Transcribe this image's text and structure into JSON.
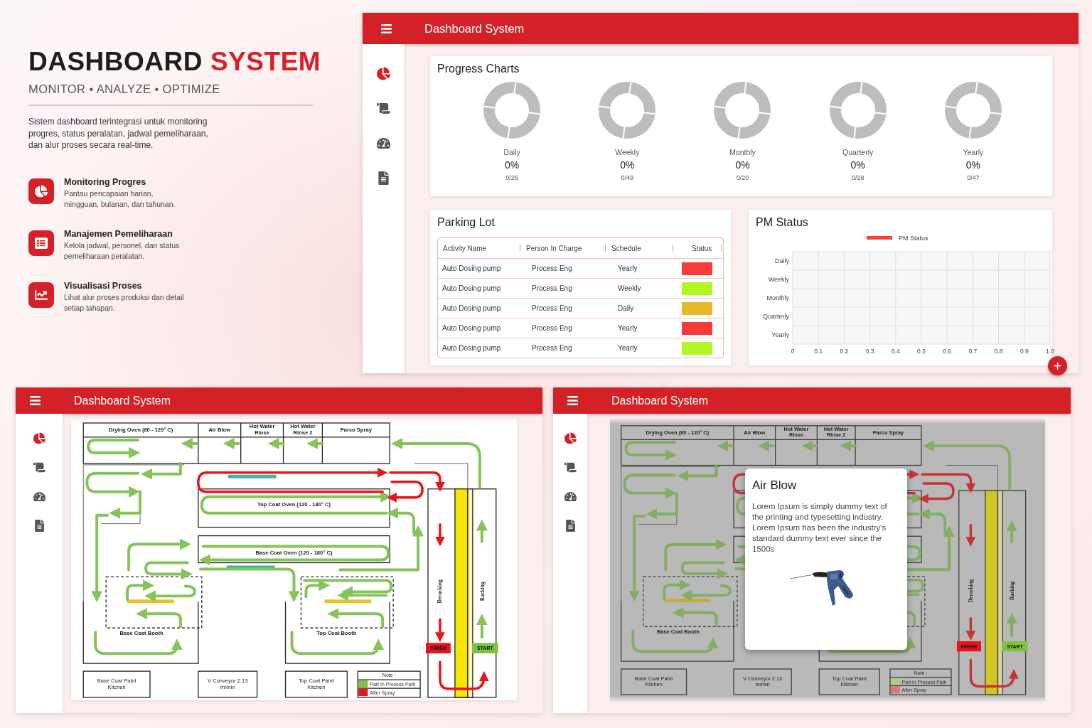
{
  "hero": {
    "title_main": "DASHBOARD",
    "title_accent": "SYSTEM",
    "tagline": "MONITOR • ANALYZE • OPTIMIZE",
    "description": "Sistem dashboard terintegrasi untuk monitoring progres, status peralatan, jadwal pemeliharaan, dan alur proses secara real-time.",
    "features": [
      {
        "title": "Monitoring Progres",
        "text": "Pantau pencapaian harian, mingguan, bulanan, dan tahunan."
      },
      {
        "title": "Manajemen Pemeliharaan",
        "text": "Kelola jadwal, personel, dan status pemeliharaan peralatan."
      },
      {
        "title": "Visualisasi Proses",
        "text": "Lihat alur proses produksi dan detail setiap tahapan."
      }
    ]
  },
  "dashboard_window": {
    "title": "Dashboard System",
    "sidebar": [
      {
        "selected": true
      },
      {
        "selected": false
      },
      {
        "selected": false
      },
      {
        "selected": false
      }
    ],
    "progress_charts": {
      "title": "Progress Charts",
      "items": [
        {
          "label": "Daily",
          "percent": "0%",
          "count": "0/26",
          "level": 0
        },
        {
          "label": "Weekly",
          "percent": "0%",
          "count": "0/49",
          "level": 0
        },
        {
          "label": "Monthly",
          "percent": "0%",
          "count": "0/20",
          "level": 0
        },
        {
          "label": "Quarterly",
          "percent": "0%",
          "count": "0/28",
          "level": 0
        },
        {
          "label": "Yearly",
          "percent": "0%",
          "count": "0/47",
          "level": 0
        }
      ]
    },
    "parking_lot": {
      "title": "Parking Lot",
      "columns": [
        "Activity Name",
        "Person In Charge",
        "Schedule",
        "Status"
      ],
      "rows": [
        {
          "activity": "Auto Dosing pump",
          "person": "Process Eng",
          "schedule": "Yearly",
          "color": "#f83a3a"
        },
        {
          "activity": "Auto Dosing pump",
          "person": "Process Eng",
          "schedule": "Weekly",
          "color": "#b2f723"
        },
        {
          "activity": "Auto Dosing pump",
          "person": "Process Eng",
          "schedule": "Daily",
          "color": "#e8b92a"
        },
        {
          "activity": "Auto Dosing pump",
          "person": "Process Eng",
          "schedule": "Yearly",
          "color": "#f83a3a"
        },
        {
          "activity": "Auto Dosing pump",
          "person": "Process Eng",
          "schedule": "Yearly",
          "color": "#b2f723"
        }
      ]
    },
    "pm_status": {
      "title": "PM Status",
      "chart_data": {
        "type": "bar",
        "orientation": "horizontal",
        "categories": [
          "Daily",
          "Weekly",
          "Monthly",
          "Quarterly",
          "Yearly"
        ],
        "series": [
          {
            "name": "PM Status",
            "color": "#f44336",
            "values": [
              0,
              0,
              0,
              0,
              0
            ]
          }
        ],
        "xlim": [
          0,
          1
        ],
        "grid": true,
        "xticks": [
          0,
          0.1,
          0.2,
          0.3,
          0.4,
          0.5,
          0.6,
          0.7,
          0.8,
          0.9,
          {
            "value": 1,
            "label": "1.0"
          }
        ]
      }
    },
    "fab": "+"
  },
  "process_windows": [
    {
      "title": "Dashboard System",
      "sidebar": [
        {
          "selected": true
        },
        {
          "selected": false
        },
        {
          "selected": false
        },
        {
          "selected": false
        }
      ],
      "diagram": {
        "stations": [
          "Drying Oven (80 - 120° C)",
          "Air Blow",
          "Hot Water Rinse",
          "Hot Water Rinse 2",
          "Parco Spray"
        ],
        "top_coat_oven": "Top Coat Oven (120 - 180° C)",
        "base_coat_oven": "Base Coat Oven (120 - 180° C)",
        "base_coat_booth": "Base Coat Booth",
        "top_coat_booth": "Top Coat Booth",
        "deracking": "Deracking",
        "racking": "Racking",
        "finish": "FINISH",
        "start": "START",
        "facilities": [
          "Base Coat Paint Kitchen",
          "V Conveyor 2.13 m/min",
          "Top Coat Paint Kitchen"
        ],
        "note": {
          "title": "Note :",
          "items": [
            {
              "label": "Part In Process Path",
              "color": "#7dc242"
            },
            {
              "label": "After Spray",
              "color": "#e8141b"
            }
          ]
        }
      }
    },
    {
      "title": "Dashboard System",
      "sidebar": [
        {
          "selected": true
        },
        {
          "selected": false
        },
        {
          "selected": false
        },
        {
          "selected": false
        }
      ],
      "diagram": {
        "stations": [
          "Drying Oven (80 - 120° C)",
          "Air Blow",
          "Hot Water Rinse",
          "Hot Water Rinse 2",
          "Parco Spray"
        ],
        "base_coat_booth": "Base Coat Booth",
        "deracking": "Deracking",
        "racking": "Racking",
        "finish": "FINISH",
        "start": "START",
        "facilities": [
          "Base Coat Paint Kitchen",
          "V Conveyor 2.13 m/min",
          "Top Coat Paint Kitchen"
        ],
        "note": {
          "title": "Note :",
          "items": [
            {
              "label": "Part In Process Path",
              "color": "#a4d184"
            },
            {
              "label": "After Spray",
              "color": "#e57373"
            }
          ]
        }
      },
      "modal": {
        "title": "Air Blow",
        "body": "Lorem Ipsum is simply dummy text of the printing and typesetting industry. Lorem Ipsum has been the industry's standard dummy text ever since the 1500s"
      }
    }
  ]
}
